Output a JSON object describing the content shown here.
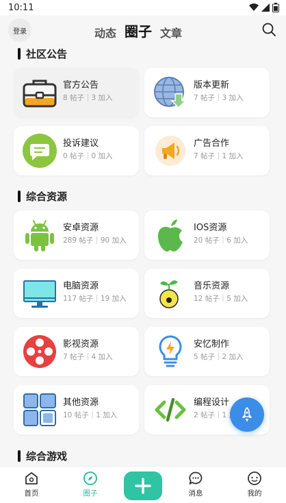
{
  "status_bar": {
    "time": "10:11"
  },
  "header": {
    "login_label": "登录",
    "tabs": [
      {
        "label": "动态",
        "active": false
      },
      {
        "label": "圈子",
        "active": true
      },
      {
        "label": "文章",
        "active": false
      }
    ]
  },
  "sections": [
    {
      "title": "社区公告",
      "cards": [
        {
          "name": "官方公告",
          "stats": "8 帖子｜3 加入",
          "icon": "briefcase-icon"
        },
        {
          "name": "版本更新",
          "stats": "7 帖子｜3 加入",
          "icon": "globe-download-icon"
        },
        {
          "name": "投诉建议",
          "stats": "0 帖子｜0 加入",
          "icon": "chat-bubble-icon"
        },
        {
          "name": "广告合作",
          "stats": "7 帖子｜1 加入",
          "icon": "megaphone-icon"
        }
      ]
    },
    {
      "title": "综合资源",
      "cards": [
        {
          "name": "安卓资源",
          "stats": "289 帖子｜90 加入",
          "icon": "android-icon"
        },
        {
          "name": "IOS资源",
          "stats": "20 帖子｜6 加入",
          "icon": "apple-icon"
        },
        {
          "name": "电脑资源",
          "stats": "117 帖子｜19 加入",
          "icon": "monitor-icon"
        },
        {
          "name": "音乐资源",
          "stats": "12 帖子｜5 加入",
          "icon": "music-sprout-icon"
        },
        {
          "name": "影视资源",
          "stats": "7 帖子｜4 加入",
          "icon": "film-reel-icon"
        },
        {
          "name": "安忆制作",
          "stats": "5 帖子｜2 加入",
          "icon": "lightbulb-icon"
        },
        {
          "name": "其他资源",
          "stats": "10 帖子｜1 加入",
          "icon": "grid-blocks-icon"
        },
        {
          "name": "编程设计",
          "stats": "2 帖子｜1 加入",
          "icon": "code-brackets-icon"
        }
      ]
    },
    {
      "title": "综合游戏",
      "cards": []
    }
  ],
  "bottom_nav": [
    {
      "label": "首页",
      "icon": "home-icon",
      "active": false
    },
    {
      "label": "圈子",
      "icon": "compass-icon",
      "active": true
    },
    {
      "label": "消息",
      "icon": "message-icon",
      "active": false
    },
    {
      "label": "我的",
      "icon": "profile-icon",
      "active": false
    }
  ],
  "colors": {
    "accent": "#2ec4a4",
    "fab": "#3c8de8",
    "android_green": "#7cc242",
    "apple_green": "#5bb84a",
    "film_red": "#e84040",
    "lightbulb_blue": "#3a8ee6"
  }
}
